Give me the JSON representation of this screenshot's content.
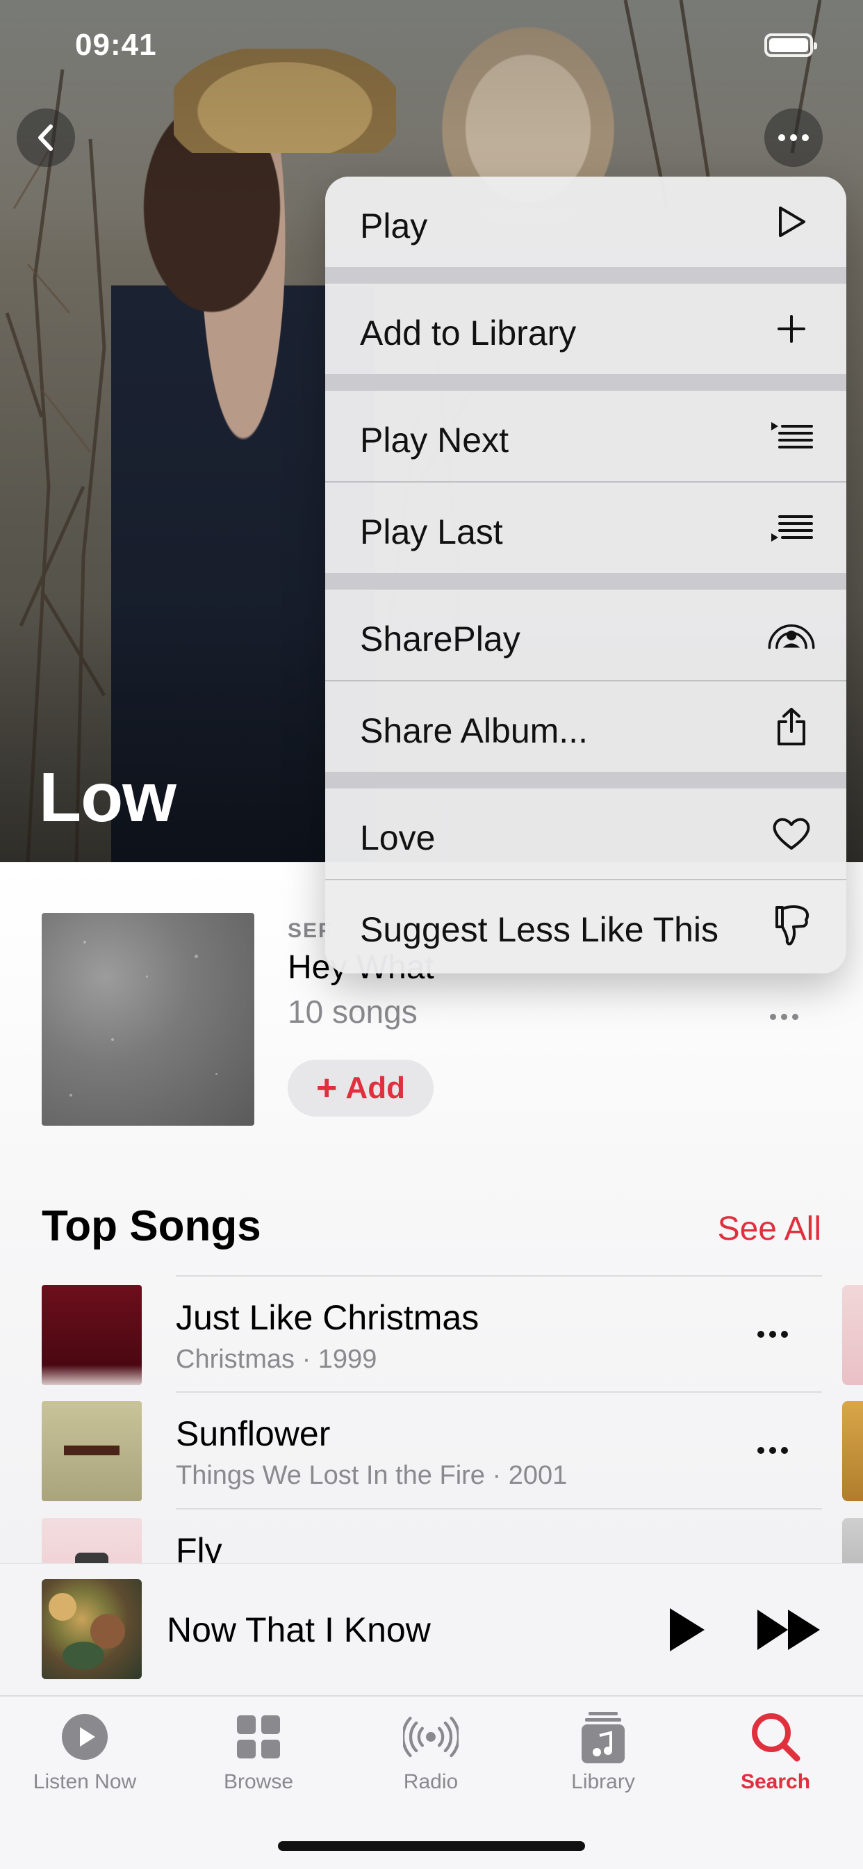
{
  "status_bar": {
    "time": "09:41"
  },
  "hero": {
    "artist_name": "Low"
  },
  "context_menu": {
    "items": [
      {
        "label": "Play",
        "icon": "play-icon"
      },
      {
        "label": "Add to Library",
        "icon": "plus-icon"
      },
      {
        "label": "Play Next",
        "icon": "play-next-icon"
      },
      {
        "label": "Play Last",
        "icon": "play-last-icon"
      },
      {
        "label": "SharePlay",
        "icon": "shareplay-icon"
      },
      {
        "label": "Share Album...",
        "icon": "share-icon"
      },
      {
        "label": "Love",
        "icon": "heart-icon"
      },
      {
        "label": "Suggest Less Like This",
        "icon": "thumbs-down-icon"
      }
    ]
  },
  "album": {
    "overline": "SEF",
    "title": "Hey What",
    "count": "10 songs",
    "add_label": "Add"
  },
  "top_songs": {
    "title": "Top Songs",
    "see_all": "See All",
    "songs": [
      {
        "title": "Just Like Christmas",
        "subtitle": "Christmas · 1999"
      },
      {
        "title": "Sunflower",
        "subtitle": "Things We Lost In the Fire · 2001"
      },
      {
        "title": "Fly",
        "subtitle": ""
      }
    ]
  },
  "mini_player": {
    "title": "Now That I Know"
  },
  "tab_bar": {
    "tabs": [
      {
        "label": "Listen Now",
        "icon": "listen-now-icon"
      },
      {
        "label": "Browse",
        "icon": "browse-icon"
      },
      {
        "label": "Radio",
        "icon": "radio-icon"
      },
      {
        "label": "Library",
        "icon": "library-icon"
      },
      {
        "label": "Search",
        "icon": "search-icon"
      }
    ],
    "active": "Search"
  },
  "colors": {
    "accent": "#e0303e",
    "secondary_text": "#8a8a8e"
  }
}
